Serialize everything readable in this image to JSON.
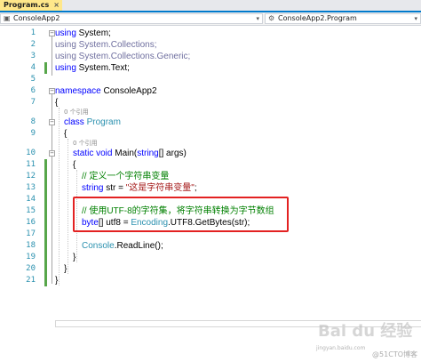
{
  "tab": {
    "title": "Program.cs",
    "close": "×"
  },
  "nav": {
    "left_label": "ConsoleApp2",
    "right_label": "ConsoleApp2.Program",
    "chevron": "▾"
  },
  "lines": [
    "1",
    "2",
    "3",
    "4",
    "5",
    "6",
    "7",
    "8",
    "9",
    "10",
    "11",
    "12",
    "13",
    "14",
    "15",
    "16",
    "17",
    "18",
    "19",
    "20",
    "21"
  ],
  "code": {
    "l1_kw": "using",
    "l1_rest": " System;",
    "l2": "using System.Collections;",
    "l3": "using System.Collections.Generic;",
    "l4_kw": "using",
    "l4_rest": " System.Text;",
    "l6_kw": "namespace",
    "l6_rest": " ConsoleApp2",
    "open_brace": "{",
    "close_brace": "}",
    "ref_hint": "0 个引用",
    "l8_kw": "class",
    "l8_type": " Program",
    "l10_kw1": "static",
    "l10_kw2": " void",
    "l10_name": " Main(",
    "l10_kw3": "string",
    "l10_rest": "[] args)",
    "l12": "// 定义一个字符串变量",
    "l13_kw": "string",
    "l13_mid": " str = ",
    "l13_str": "\"这是字符串变量\"",
    "l13_end": ";",
    "l15": "// 使用UTF-8的字符集，将字符串转换为字节数组",
    "l16_kw": "byte",
    "l16_mid": "[] utf8 = ",
    "l16_type": "Encoding",
    "l16_rest": ".UTF8.GetBytes(str);",
    "l18_type": "Console",
    "l18_rest": ".ReadLine();"
  },
  "watermark": {
    "logo": "Bai du 经验",
    "site": "jingyan.baidu.com",
    "credit": "@51CTO博客"
  }
}
